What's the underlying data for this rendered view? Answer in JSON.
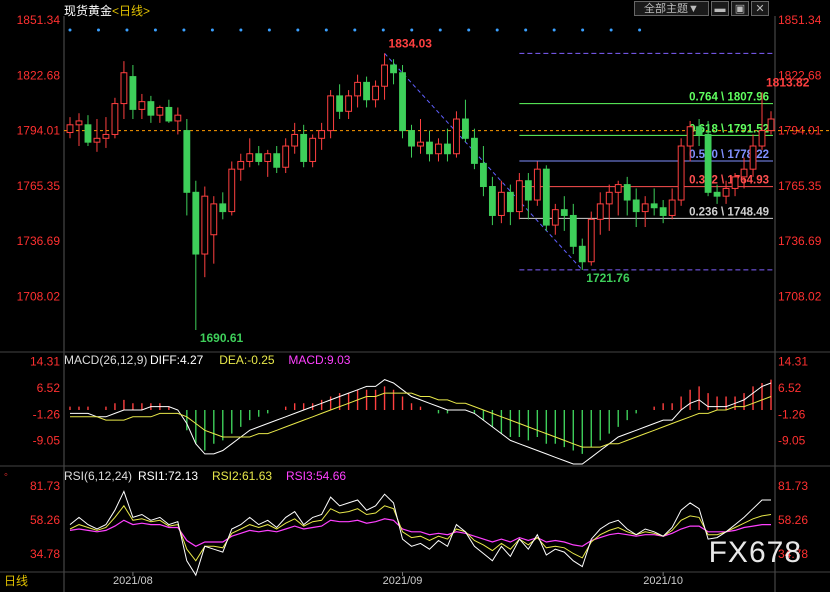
{
  "header": {
    "instrument": "现货黄金",
    "period_label": "<日线>",
    "topic_dropdown": "全部主题",
    "dropdown_arrow": "▼"
  },
  "bottom_period": "日线",
  "watermark": "FX678",
  "colors": {
    "up": "#ff4040",
    "down": "#3ecf5a",
    "axis_text": "#ff3030",
    "dotted_ref": "#ff9a00",
    "diff_line": "#ffffff",
    "dea_line": "#e8e84a",
    "macd_text": "#ff40ff",
    "rsi1": "#ffffff",
    "rsi2": "#e8e84a",
    "rsi3": "#ff40ff",
    "fib_0764": "#60ff60",
    "fib_0618": "#60ff60",
    "fib_0500": "#8090ff",
    "fib_0382": "#ff5050",
    "fib_0236": "#d0d0d0",
    "dots": "#3aa0ff"
  },
  "chart_data": [
    {
      "type": "candlestick",
      "title": "现货黄金<日线>",
      "ylim": [
        1690.61,
        1851.34
      ],
      "y_ticks": [
        "1851.34",
        "1822.68",
        "1794.01",
        "1765.35",
        "1736.69",
        "1708.02"
      ],
      "x_ticks": [
        "2021/08",
        "2021/09",
        "2021/10"
      ],
      "annotations": [
        {
          "label": "1834.03",
          "value": 1834.03,
          "type": "high"
        },
        {
          "label": "1813.82",
          "value": 1813.82,
          "type": "high"
        },
        {
          "label": "1721.76",
          "value": 1721.76,
          "type": "low"
        },
        {
          "label": "1690.61",
          "value": 1690.61,
          "type": "low"
        }
      ],
      "fibonacci": [
        {
          "label": "0.764 \\ 1807.96",
          "value": 1807.96,
          "color": "#60ff60"
        },
        {
          "label": "0.618 \\ 1791.52",
          "value": 1791.52,
          "color": "#60ff60"
        },
        {
          "label": "0.500 \\ 1778.22",
          "value": 1778.22,
          "color": "#8090ff"
        },
        {
          "label": "0.382 \\ 1764.93",
          "value": 1764.93,
          "color": "#ff5050"
        },
        {
          "label": "0.236 \\ 1748.49",
          "value": 1748.49,
          "color": "#d0d0d0"
        }
      ],
      "fib_bounds": [
        1834.03,
        1721.76
      ],
      "reference_line": 1794.01,
      "candles": [
        [
          1793,
          1801,
          1790,
          1797
        ],
        [
          1797,
          1803,
          1786,
          1799
        ],
        [
          1797,
          1802,
          1786,
          1788
        ],
        [
          1788,
          1800,
          1783,
          1790
        ],
        [
          1790,
          1801,
          1785,
          1792
        ],
        [
          1792,
          1811,
          1790,
          1808
        ],
        [
          1808,
          1830,
          1800,
          1824
        ],
        [
          1822,
          1828,
          1800,
          1805
        ],
        [
          1805,
          1813,
          1800,
          1809
        ],
        [
          1809,
          1812,
          1798,
          1802
        ],
        [
          1802,
          1807,
          1798,
          1806
        ],
        [
          1806,
          1810,
          1798,
          1799
        ],
        [
          1799,
          1806,
          1792,
          1802
        ],
        [
          1794,
          1800,
          1750,
          1762
        ],
        [
          1762,
          1768,
          1690.61,
          1730
        ],
        [
          1730,
          1765,
          1718,
          1760
        ],
        [
          1740,
          1760,
          1725,
          1756
        ],
        [
          1756,
          1762,
          1748,
          1752
        ],
        [
          1752,
          1778,
          1750,
          1774
        ],
        [
          1774,
          1782,
          1768,
          1778
        ],
        [
          1778,
          1790,
          1775,
          1782
        ],
        [
          1782,
          1786,
          1776,
          1778
        ],
        [
          1778,
          1784,
          1770,
          1782
        ],
        [
          1782,
          1786,
          1772,
          1775
        ],
        [
          1775,
          1790,
          1772,
          1786
        ],
        [
          1786,
          1798,
          1782,
          1792
        ],
        [
          1792,
          1797,
          1775,
          1778
        ],
        [
          1778,
          1792,
          1775,
          1790
        ],
        [
          1790,
          1798,
          1784,
          1794
        ],
        [
          1794,
          1815,
          1790,
          1812
        ],
        [
          1812,
          1818,
          1800,
          1804
        ],
        [
          1804,
          1815,
          1800,
          1812
        ],
        [
          1812,
          1823,
          1806,
          1819
        ],
        [
          1819,
          1822,
          1806,
          1810
        ],
        [
          1810,
          1820,
          1806,
          1817
        ],
        [
          1817,
          1834.03,
          1810,
          1828
        ],
        [
          1828,
          1831,
          1818,
          1824
        ],
        [
          1824,
          1828,
          1790,
          1794
        ],
        [
          1794,
          1797,
          1780,
          1786
        ],
        [
          1786,
          1800,
          1782,
          1788
        ],
        [
          1788,
          1794,
          1778,
          1782
        ],
        [
          1782,
          1790,
          1778,
          1787
        ],
        [
          1787,
          1795,
          1778,
          1782
        ],
        [
          1782,
          1804,
          1780,
          1800
        ],
        [
          1800,
          1810,
          1788,
          1790
        ],
        [
          1790,
          1795,
          1774,
          1777
        ],
        [
          1777,
          1786,
          1760,
          1765
        ],
        [
          1765,
          1770,
          1745,
          1750
        ],
        [
          1750,
          1768,
          1746,
          1762
        ],
        [
          1762,
          1766,
          1745,
          1752
        ],
        [
          1752,
          1772,
          1748,
          1768
        ],
        [
          1768,
          1772,
          1748,
          1758
        ],
        [
          1758,
          1778,
          1755,
          1774
        ],
        [
          1774,
          1776,
          1742,
          1745
        ],
        [
          1745,
          1756,
          1740,
          1753
        ],
        [
          1753,
          1760,
          1742,
          1750
        ],
        [
          1750,
          1756,
          1730,
          1734
        ],
        [
          1734,
          1738,
          1721.76,
          1726
        ],
        [
          1726,
          1752,
          1724,
          1748
        ],
        [
          1748,
          1762,
          1740,
          1756
        ],
        [
          1756,
          1766,
          1742,
          1762
        ],
        [
          1762,
          1768,
          1750,
          1766
        ],
        [
          1766,
          1770,
          1750,
          1758
        ],
        [
          1758,
          1764,
          1744,
          1752
        ],
        [
          1752,
          1760,
          1744,
          1756
        ],
        [
          1756,
          1764,
          1750,
          1754
        ],
        [
          1754,
          1758,
          1746,
          1750
        ],
        [
          1750,
          1764,
          1748,
          1758
        ],
        [
          1758,
          1790,
          1755,
          1786
        ],
        [
          1786,
          1799,
          1778,
          1796
        ],
        [
          1796,
          1800,
          1786,
          1792
        ],
        [
          1792,
          1799,
          1760,
          1762
        ],
        [
          1762,
          1766,
          1756,
          1760
        ],
        [
          1760,
          1768,
          1756,
          1764
        ],
        [
          1764,
          1772,
          1760,
          1770
        ],
        [
          1770,
          1780,
          1764,
          1774
        ],
        [
          1774,
          1792,
          1770,
          1786
        ],
        [
          1786,
          1813.82,
          1784,
          1794
        ],
        [
          1794,
          1804,
          1792,
          1800
        ]
      ]
    },
    {
      "type": "bar",
      "title": "MACD(26,12,9)",
      "legend": [
        {
          "name": "DIFF:4.27",
          "color": "#ffffff"
        },
        {
          "name": "DEA:-0.25",
          "color": "#e8e84a"
        },
        {
          "name": "MACD:9.03",
          "color": "#ff40ff"
        }
      ],
      "ylim": [
        -16.0,
        16.0
      ],
      "y_ticks": [
        "14.31",
        "6.52",
        "-1.26",
        "-9.05"
      ],
      "macd": [
        1,
        1,
        1,
        0,
        1,
        2,
        3,
        2,
        2,
        2,
        2,
        1,
        0,
        -6,
        -10,
        -12,
        -10,
        -9,
        -7,
        -5,
        -3,
        -2,
        -1,
        0,
        1,
        2,
        2,
        2,
        3,
        4,
        5,
        5,
        6,
        6,
        6,
        7,
        6,
        4,
        2,
        1,
        0,
        -1,
        -1,
        0,
        0,
        -1,
        -3,
        -5,
        -7,
        -8,
        -8,
        -9,
        -8,
        -10,
        -10,
        -11,
        -12,
        -13,
        -11,
        -9,
        -7,
        -5,
        -3,
        -1,
        0,
        1,
        2,
        2,
        4,
        6,
        7,
        5,
        4,
        4,
        4,
        5,
        7,
        8,
        9
      ],
      "diff": [
        -1,
        -1,
        -1,
        -2,
        -2,
        -1,
        0,
        0,
        0,
        1,
        1,
        1,
        0,
        -4,
        -10,
        -13,
        -13,
        -12,
        -10,
        -8,
        -6,
        -5,
        -4,
        -3,
        -2,
        -1,
        0,
        1,
        2,
        3,
        4,
        5,
        6,
        7,
        7,
        9,
        8,
        6,
        4,
        3,
        2,
        1,
        0,
        0,
        0,
        -1,
        -3,
        -5,
        -7,
        -9,
        -10,
        -11,
        -12,
        -13,
        -14,
        -15,
        -16,
        -16,
        -14,
        -12,
        -10,
        -8,
        -7,
        -6,
        -5,
        -4,
        -3,
        -3,
        0,
        2,
        3,
        1,
        1,
        1,
        2,
        3,
        5,
        7,
        8
      ],
      "dea": [
        -2,
        -2,
        -2,
        -2,
        -3,
        -3,
        -3,
        -2,
        -2,
        -2,
        -1,
        -1,
        -1,
        -2,
        -4,
        -6,
        -7,
        -8,
        -8,
        -8,
        -8,
        -7,
        -7,
        -6,
        -5,
        -4,
        -3,
        -2,
        -1,
        0,
        1,
        2,
        3,
        4,
        4,
        5,
        5,
        5,
        5,
        4,
        4,
        3,
        3,
        2,
        2,
        1,
        0,
        -1,
        -2,
        -3,
        -4,
        -5,
        -6,
        -7,
        -8,
        -9,
        -10,
        -11,
        -11,
        -11,
        -10,
        -10,
        -9,
        -8,
        -7,
        -6,
        -5,
        -4,
        -3,
        -2,
        -1,
        -1,
        0,
        0,
        1,
        1,
        2,
        3,
        4
      ]
    },
    {
      "type": "line",
      "title": "RSI(6,12,24)",
      "legend": [
        {
          "name": "RSI1:72.13",
          "color": "#ffffff"
        },
        {
          "name": "RSI2:61.63",
          "color": "#e8e84a"
        },
        {
          "name": "RSI3:54.66",
          "color": "#ff40ff"
        }
      ],
      "ylim": [
        25,
        90
      ],
      "y_ticks": [
        "81.73",
        "58.26",
        "34.78"
      ],
      "x_ticks": [
        "2021/08",
        "2021/09",
        "2021/10"
      ],
      "rsi1": [
        55,
        60,
        55,
        52,
        55,
        65,
        78,
        60,
        62,
        58,
        60,
        55,
        57,
        30,
        20,
        40,
        38,
        36,
        52,
        55,
        60,
        55,
        58,
        53,
        60,
        64,
        55,
        60,
        62,
        74,
        68,
        70,
        72,
        65,
        68,
        76,
        70,
        45,
        40,
        42,
        38,
        44,
        40,
        55,
        50,
        40,
        35,
        30,
        40,
        33,
        45,
        38,
        48,
        34,
        38,
        36,
        30,
        26,
        45,
        52,
        56,
        58,
        52,
        48,
        52,
        50,
        47,
        53,
        65,
        70,
        66,
        45,
        46,
        50,
        55,
        60,
        66,
        72,
        72
      ],
      "rsi2": [
        52,
        55,
        53,
        51,
        53,
        60,
        68,
        58,
        59,
        57,
        58,
        54,
        55,
        38,
        30,
        40,
        40,
        39,
        49,
        52,
        55,
        53,
        55,
        52,
        56,
        59,
        54,
        57,
        58,
        66,
        63,
        64,
        66,
        62,
        63,
        68,
        66,
        50,
        46,
        47,
        44,
        47,
        45,
        52,
        50,
        44,
        41,
        37,
        42,
        38,
        45,
        41,
        46,
        39,
        40,
        39,
        35,
        32,
        43,
        48,
        51,
        53,
        50,
        48,
        50,
        49,
        47,
        51,
        58,
        61,
        60,
        48,
        48,
        50,
        53,
        56,
        59,
        61,
        62
      ],
      "rsi3": [
        51,
        52,
        51,
        50,
        51,
        54,
        58,
        55,
        56,
        55,
        55,
        53,
        53,
        44,
        40,
        43,
        43,
        43,
        47,
        49,
        51,
        50,
        51,
        50,
        52,
        54,
        52,
        53,
        54,
        58,
        57,
        57,
        58,
        56,
        57,
        59,
        58,
        52,
        50,
        50,
        48,
        49,
        48,
        50,
        49,
        47,
        45,
        43,
        45,
        43,
        46,
        44,
        46,
        43,
        44,
        43,
        41,
        40,
        44,
        46,
        48,
        49,
        48,
        47,
        48,
        48,
        47,
        49,
        52,
        54,
        54,
        50,
        50,
        50,
        51,
        53,
        54,
        55,
        55
      ]
    }
  ]
}
